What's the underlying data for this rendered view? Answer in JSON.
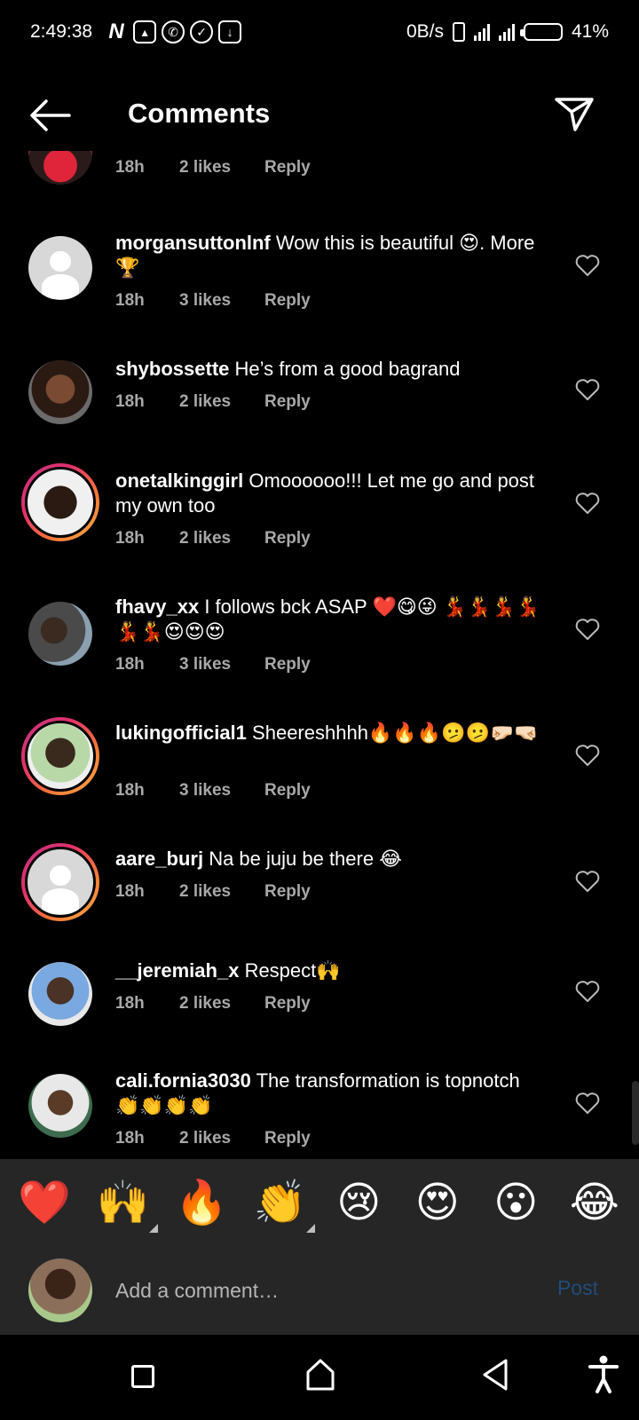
{
  "status_bar": {
    "time": "2:49:38",
    "network_speed": "0B/s",
    "battery": "41%",
    "battery_level": 0.41,
    "icons": [
      "netflix-icon",
      "gallery-icon",
      "whatsapp-icon",
      "check-circle-icon",
      "download-icon"
    ]
  },
  "header": {
    "title": "Comments"
  },
  "comments": [
    {
      "user": "",
      "text": "",
      "time": "18h",
      "likes": "2 likes",
      "reply": "Reply"
    },
    {
      "user": "morgansuttonlnf",
      "text": "Wow this is beautiful 😍. More 🏆",
      "time": "18h",
      "likes": "3 likes",
      "reply": "Reply"
    },
    {
      "user": "shybossette",
      "text": "He’s from a good bagrand",
      "time": "18h",
      "likes": "2 likes",
      "reply": "Reply"
    },
    {
      "user": "onetalkinggirl",
      "text": "Omoooooo!!! Let me go and post my own too",
      "time": "18h",
      "likes": "2 likes",
      "reply": "Reply"
    },
    {
      "user": "fhavy_xx",
      "text": "I follows bck ASAP ❤️😋😜 💃💃💃💃💃💃😍😍😍",
      "time": "18h",
      "likes": "3 likes",
      "reply": "Reply"
    },
    {
      "user": "lukingofficial1",
      "text": "Sheereshhhh🔥🔥🔥🫤🫤🤛🏻🤜🏻",
      "time": "18h",
      "likes": "3 likes",
      "reply": "Reply"
    },
    {
      "user": "aare_burj",
      "text": "Na be juju be there 😂",
      "time": "18h",
      "likes": "2 likes",
      "reply": "Reply"
    },
    {
      "user": "__jeremiah_x",
      "text": "Respect🙌",
      "time": "18h",
      "likes": "2 likes",
      "reply": "Reply"
    },
    {
      "user": "cali.fornia3030",
      "text": "The transformation is topnotch 👏👏👏👏",
      "time": "18h",
      "likes": "2 likes",
      "reply": "Reply"
    }
  ],
  "emoji_bar": [
    "❤️",
    "🙌",
    "🔥",
    "👏",
    "😢",
    "😍",
    "😮",
    "😂"
  ],
  "input": {
    "placeholder": "Add a comment…",
    "post_label": "Post"
  },
  "colors": {
    "background": "#000000",
    "panel": "#262626",
    "meta_text": "#a8a8a8",
    "post_disabled": "#1f4d7a"
  }
}
